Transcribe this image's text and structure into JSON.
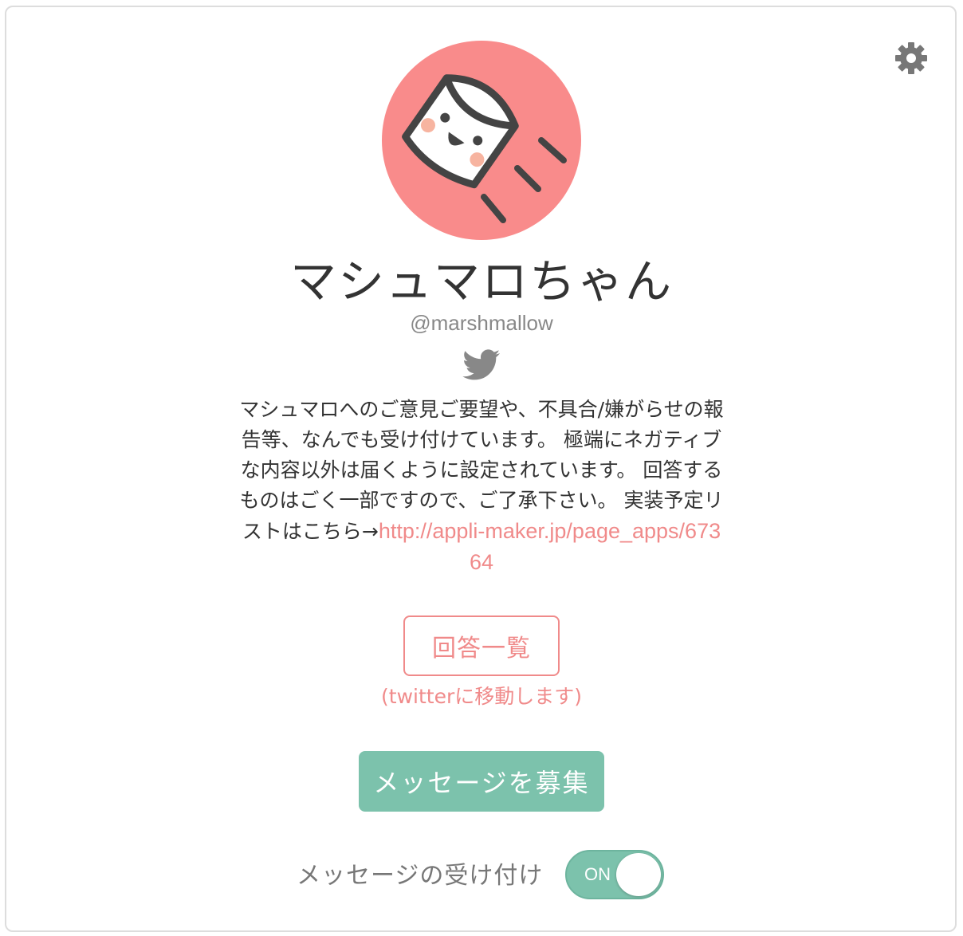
{
  "profile": {
    "name": "マシュマロちゃん",
    "handle": "@marshmallow",
    "bio_text": "マシュマロへのご意見ご要望や、不具合/嫌がらせの報告等、なんでも受け付けています。 極端にネガティブな内容以外は届くように設定されています。 回答するものはごく一部ですので、ご了承下さい。 実装予定リストはこちら→",
    "bio_link": "http://appli-maker.jp/page_apps/67364"
  },
  "actions": {
    "answers_label": "回答一覧",
    "answers_note": "(twitterに移動します)",
    "recruit_label": "メッセージを募集"
  },
  "settings": {
    "accept_label": "メッセージの受け付け",
    "toggle_state": "ON"
  },
  "icons": {
    "settings": "gear-icon",
    "social": "twitter-bird-icon",
    "avatar": "marshmallow-avatar"
  },
  "colors": {
    "accent_pink": "#f08a8a",
    "avatar_bg": "#f98b8b",
    "accent_green": "#7cc2ac"
  }
}
